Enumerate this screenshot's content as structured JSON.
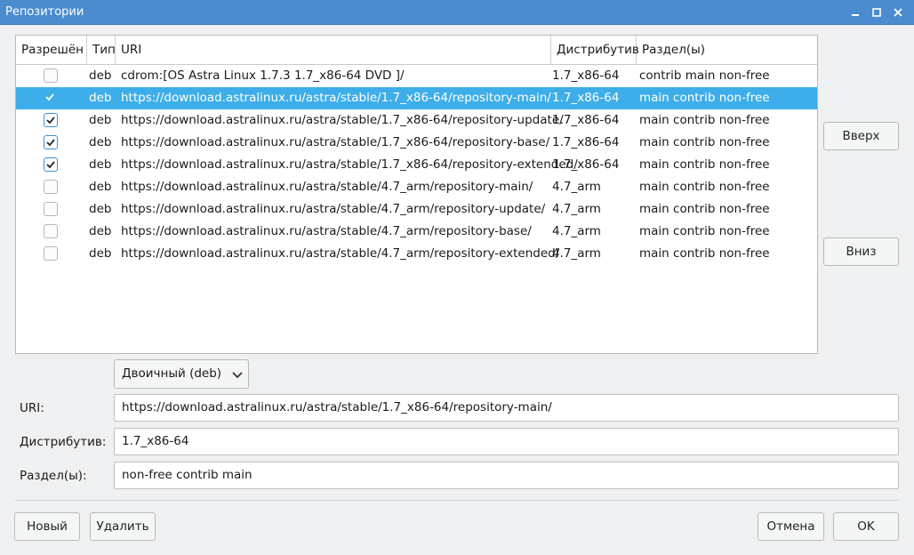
{
  "window": {
    "title": "Репозитории"
  },
  "table": {
    "headers": [
      "Разрешён",
      "Тип",
      "URI",
      "Дистрибутив",
      "Раздел(ы)"
    ],
    "rows": [
      {
        "enabled": false,
        "type": "deb",
        "uri": "cdrom:[OS Astra Linux 1.7.3 1.7_x86-64 DVD ]/",
        "dist": "1.7_x86-64",
        "sections": "contrib main non-free",
        "selected": false
      },
      {
        "enabled": true,
        "type": "deb",
        "uri": "https://download.astralinux.ru/astra/stable/1.7_x86-64/repository-main/",
        "dist": "1.7_x86-64",
        "sections": "main contrib non-free",
        "selected": true
      },
      {
        "enabled": true,
        "type": "deb",
        "uri": "https://download.astralinux.ru/astra/stable/1.7_x86-64/repository-update/",
        "dist": "1.7_x86-64",
        "sections": "main contrib non-free",
        "selected": false
      },
      {
        "enabled": true,
        "type": "deb",
        "uri": "https://download.astralinux.ru/astra/stable/1.7_x86-64/repository-base/",
        "dist": "1.7_x86-64",
        "sections": "main contrib non-free",
        "selected": false
      },
      {
        "enabled": true,
        "type": "deb",
        "uri": "https://download.astralinux.ru/astra/stable/1.7_x86-64/repository-extended/",
        "dist": "1.7_x86-64",
        "sections": "main contrib non-free",
        "selected": false
      },
      {
        "enabled": false,
        "type": "deb",
        "uri": "https://download.astralinux.ru/astra/stable/4.7_arm/repository-main/",
        "dist": "4.7_arm",
        "sections": "main contrib non-free",
        "selected": false
      },
      {
        "enabled": false,
        "type": "deb",
        "uri": "https://download.astralinux.ru/astra/stable/4.7_arm/repository-update/",
        "dist": "4.7_arm",
        "sections": "main contrib non-free",
        "selected": false
      },
      {
        "enabled": false,
        "type": "deb",
        "uri": "https://download.astralinux.ru/astra/stable/4.7_arm/repository-base/",
        "dist": "4.7_arm",
        "sections": "main contrib non-free",
        "selected": false
      },
      {
        "enabled": false,
        "type": "deb",
        "uri": "https://download.astralinux.ru/astra/stable/4.7_arm/repository-extended/",
        "dist": "4.7_arm",
        "sections": "main contrib non-free",
        "selected": false
      }
    ]
  },
  "side_buttons": {
    "up": "Вверх",
    "down": "Вниз"
  },
  "editor": {
    "type_select": "Двоичный (deb)",
    "uri_label": "URI:",
    "uri_value": "https://download.astralinux.ru/astra/stable/1.7_x86-64/repository-main/",
    "dist_label": "Дистрибутив:",
    "dist_value": "1.7_x86-64",
    "sections_label": "Раздел(ы):",
    "sections_value": "non-free contrib main"
  },
  "footer": {
    "new": "Новый",
    "delete": "Удалить",
    "cancel": "Отмена",
    "ok": "OK"
  },
  "colors": {
    "titlebar": "#4a8ccf",
    "selection": "#3daee9",
    "checkbox_accent": "#3a8fd6"
  }
}
